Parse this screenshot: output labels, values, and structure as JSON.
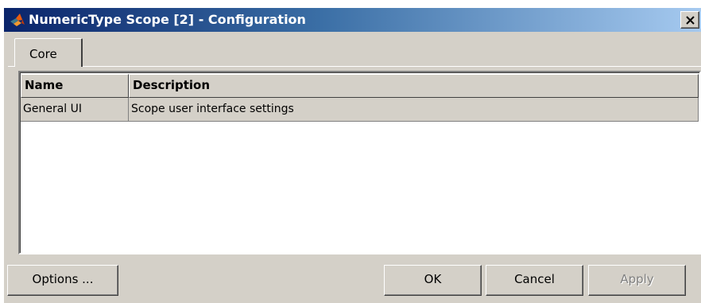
{
  "window": {
    "title": "NumericType Scope [2] - Configuration",
    "close_label": "X"
  },
  "tabs": [
    {
      "label": "Core",
      "active": true
    }
  ],
  "table": {
    "columns": [
      "Name",
      "Description"
    ],
    "rows": [
      {
        "name": "General UI",
        "description": "Scope user interface settings"
      }
    ]
  },
  "buttons": {
    "options": "Options ...",
    "ok": "OK",
    "cancel": "Cancel",
    "apply": "Apply",
    "apply_enabled": false
  },
  "icons": {
    "app": "matlab-logo-icon",
    "close": "close-icon"
  },
  "colors": {
    "titlebar_start": "#0a246a",
    "titlebar_end": "#a6caf0",
    "face": "#d4d0c8",
    "disabled_text": "#808080"
  }
}
